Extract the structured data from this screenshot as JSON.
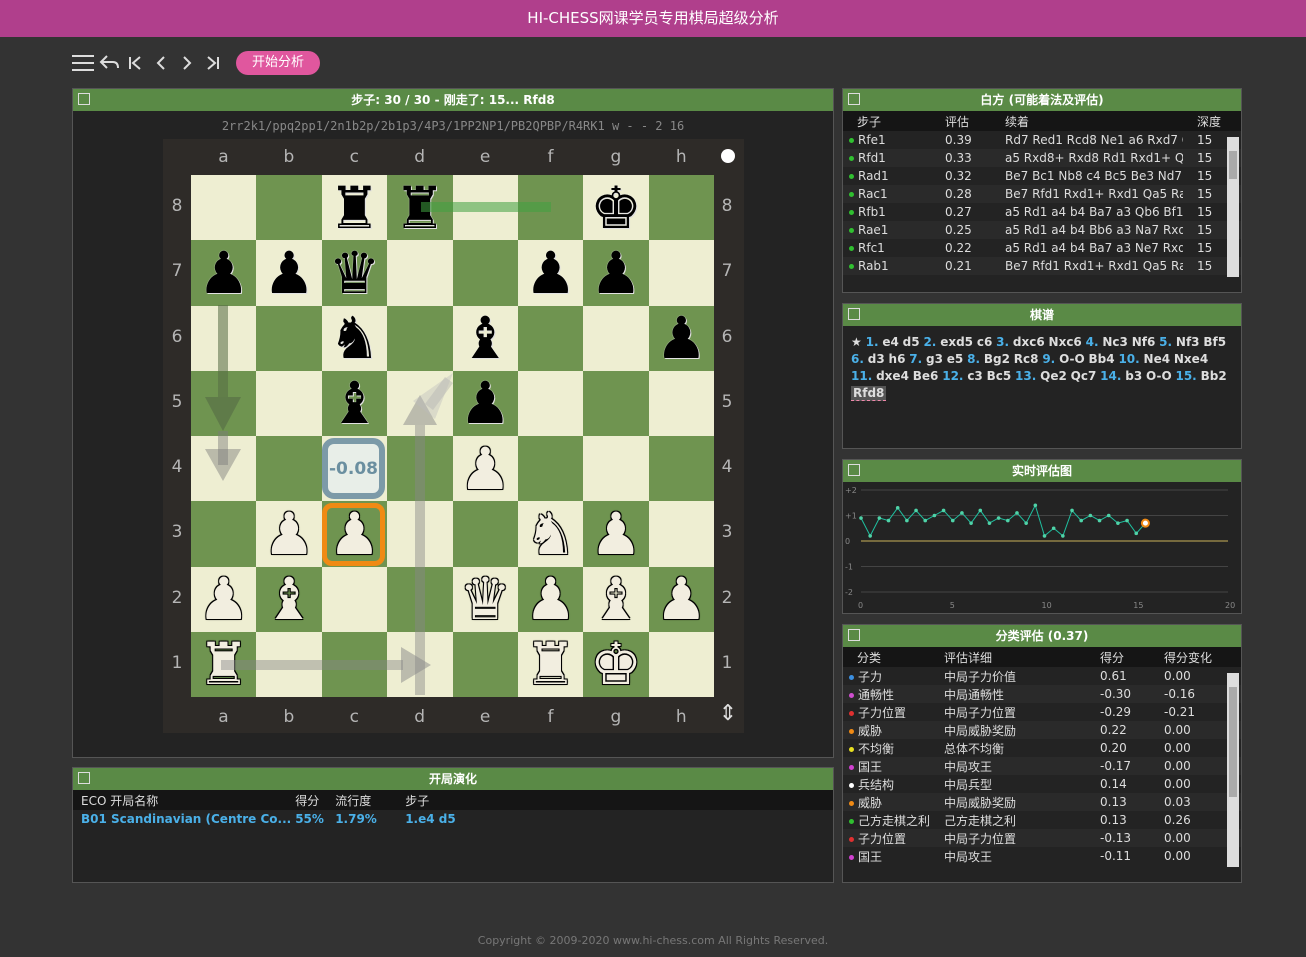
{
  "app": {
    "title": "HI-CHESS网课学员专用棋局超级分析"
  },
  "toolbar": {
    "analyze_label": "开始分析"
  },
  "board_panel": {
    "title": "步子: 30 / 30 - 刚走了: 15... Rfd8",
    "fen": "2rr2k1/ppq2pp1/2n1b2p/2b1p3/4P3/1PP2NP1/PB2QPBP/R4RK1 w - - 2 16",
    "files": [
      "a",
      "b",
      "c",
      "d",
      "e",
      "f",
      "g",
      "h"
    ],
    "ranks": [
      "8",
      "7",
      "6",
      "5",
      "4",
      "3",
      "2",
      "1"
    ],
    "eval_label": "-0.08",
    "position": [
      [
        "",
        "",
        "bR",
        "bR",
        "",
        "",
        "bK",
        ""
      ],
      [
        "bP",
        "bP",
        "bQ",
        "",
        "",
        "bP",
        "bP",
        ""
      ],
      [
        "",
        "",
        "bN",
        "",
        "bB",
        "",
        "",
        "bP"
      ],
      [
        "",
        "",
        "bB",
        "",
        "bP",
        "",
        "",
        ""
      ],
      [
        "",
        "",
        "",
        "",
        "wP",
        "",
        "",
        ""
      ],
      [
        "",
        "wP",
        "wP",
        "",
        "",
        "wN",
        "wP",
        ""
      ],
      [
        "wP",
        "wB",
        "",
        "",
        "wQ",
        "wP",
        "wB",
        "wP"
      ],
      [
        "wR",
        "",
        "",
        "",
        "",
        "wR",
        "wK",
        ""
      ]
    ]
  },
  "white_panel": {
    "title": "白方 (可能着法及评估)",
    "headers": [
      "步子",
      "评估",
      "续着",
      "深度"
    ],
    "rows": [
      {
        "move": "Rfe1",
        "eval": "0.39",
        "line": "Rd7 Red1 Rcd8 Ne1 a6 Rxd7 Q...",
        "depth": "15"
      },
      {
        "move": "Rfd1",
        "eval": "0.33",
        "line": "a5 Rxd8+ Rxd8 Rd1 Rxd1+ Qxd...",
        "depth": "15"
      },
      {
        "move": "Rad1",
        "eval": "0.32",
        "line": "Be7 Bc1 Nb8 c4 Bc5 Be3 Nd7 B...",
        "depth": "15"
      },
      {
        "move": "Rac1",
        "eval": "0.28",
        "line": "Be7 Rfd1 Rxd1+ Rxd1 Qa5 Ra1 ...",
        "depth": "15"
      },
      {
        "move": "Rfb1",
        "eval": "0.27",
        "line": "a5 Rd1 a4 b4 Ba7 a3 Qb6 Bf1 B...",
        "depth": "15"
      },
      {
        "move": "Rae1",
        "eval": "0.25",
        "line": "a5 Rd1 a4 b4 Bb6 a3 Na7 Rxd8...",
        "depth": "15"
      },
      {
        "move": "Rfc1",
        "eval": "0.22",
        "line": "a5 Rd1 a4 b4 Ba7 a3 Ne7 Rxd8...",
        "depth": "15"
      },
      {
        "move": "Rab1",
        "eval": "0.21",
        "line": "Be7 Rfd1 Rxd1+ Rxd1 Qa5 Ra1 ...",
        "depth": "15"
      }
    ]
  },
  "score_panel": {
    "title": "棋谱",
    "star": "★",
    "moves": [
      {
        "n": "1.",
        "w": "e4",
        "b": "d5"
      },
      {
        "n": "2.",
        "w": "exd5",
        "b": "c6"
      },
      {
        "n": "3.",
        "w": "dxc6",
        "b": "Nxc6"
      },
      {
        "n": "4.",
        "w": "Nc3",
        "b": "Nf6"
      },
      {
        "n": "5.",
        "w": "Nf3",
        "b": "Bf5"
      },
      {
        "n": "6.",
        "w": "d3",
        "b": "h6"
      },
      {
        "n": "7.",
        "w": "g3",
        "b": "e5"
      },
      {
        "n": "8.",
        "w": "Bg2",
        "b": "Rc8"
      },
      {
        "n": "9.",
        "w": "O-O",
        "b": "Bb4"
      },
      {
        "n": "10.",
        "w": "Ne4",
        "b": "Nxe4"
      },
      {
        "n": "11.",
        "w": "dxe4",
        "b": "Be6"
      },
      {
        "n": "12.",
        "w": "c3",
        "b": "Bc5"
      },
      {
        "n": "13.",
        "w": "Qe2",
        "b": "Qc7"
      },
      {
        "n": "14.",
        "w": "b3",
        "b": "O-O"
      },
      {
        "n": "15.",
        "w": "Bb2",
        "b": "Rfd8"
      }
    ]
  },
  "chart_panel": {
    "title": "实时评估图",
    "chart_data": {
      "type": "line",
      "x_ticks": [
        "0",
        "5",
        "10",
        "15",
        "20"
      ],
      "y_ticks": [
        "+2",
        "+1",
        "0",
        "-1",
        "-2"
      ],
      "xlim": [
        0,
        20
      ],
      "ylim": [
        -2,
        2
      ],
      "values": [
        0.9,
        0.2,
        0.9,
        0.8,
        1.3,
        0.8,
        1.2,
        0.8,
        1.0,
        1.2,
        0.8,
        1.1,
        0.7,
        1.2,
        0.7,
        0.9,
        0.8,
        1.1,
        0.7,
        1.4,
        0.2,
        0.5,
        0.2,
        1.2,
        0.8,
        1.0,
        0.8,
        1.0,
        0.7,
        0.8,
        0.3,
        0.7
      ],
      "colors": {
        "line": "#1fbf9f",
        "marker": "#4fd3a8",
        "current": "#f08a14",
        "zero": "#c8b058"
      }
    }
  },
  "cat_panel": {
    "title": "分类评估 (0.37)",
    "headers": [
      "分类",
      "评估详细",
      "得分",
      "得分变化"
    ],
    "rows": [
      {
        "cat": "子力",
        "detail": "中局子力价值",
        "score": "0.61",
        "change": "0.00",
        "color": "#3b8fe0"
      },
      {
        "cat": "通畅性",
        "detail": "中局通畅性",
        "score": "-0.30",
        "change": "-0.16",
        "color": "#d04fd0"
      },
      {
        "cat": "子力位置",
        "detail": "中局子力位置",
        "score": "-0.29",
        "change": "-0.21",
        "color": "#e03030"
      },
      {
        "cat": "威胁",
        "detail": "中局威胁奖励",
        "score": "0.22",
        "change": "0.00",
        "color": "#f08a14"
      },
      {
        "cat": "不均衡",
        "detail": "总体不均衡",
        "score": "0.20",
        "change": "0.00",
        "color": "#e8e020"
      },
      {
        "cat": "国王",
        "detail": "中局攻王",
        "score": "-0.17",
        "change": "0.00",
        "color": "#d040d0"
      },
      {
        "cat": "兵结构",
        "detail": "中局兵型",
        "score": "0.14",
        "change": "0.00",
        "color": "#ffffff"
      },
      {
        "cat": "威胁",
        "detail": "中局威胁奖励",
        "score": "0.13",
        "change": "0.03",
        "color": "#f08a14"
      },
      {
        "cat": "己方走棋之利",
        "detail": "己方走棋之利",
        "score": "0.13",
        "change": "0.26",
        "color": "#30c030"
      },
      {
        "cat": "子力位置",
        "detail": "中局子力位置",
        "score": "-0.13",
        "change": "0.00",
        "color": "#e03030"
      },
      {
        "cat": "国王",
        "detail": "中局攻王",
        "score": "-0.11",
        "change": "0.00",
        "color": "#d040d0"
      }
    ]
  },
  "opening_panel": {
    "title": "开局演化",
    "headers": [
      "ECO 开局名称",
      "得分",
      "流行度",
      "步子"
    ],
    "rows": [
      {
        "name": "B01 Scandinavian (Centre Co...",
        "score": "55%",
        "pop": "1.79%",
        "moves": "1.e4 d5"
      }
    ]
  },
  "footer": {
    "text": "Copyright © 2009-2020 www.hi-chess.com All Rights Reserved."
  }
}
